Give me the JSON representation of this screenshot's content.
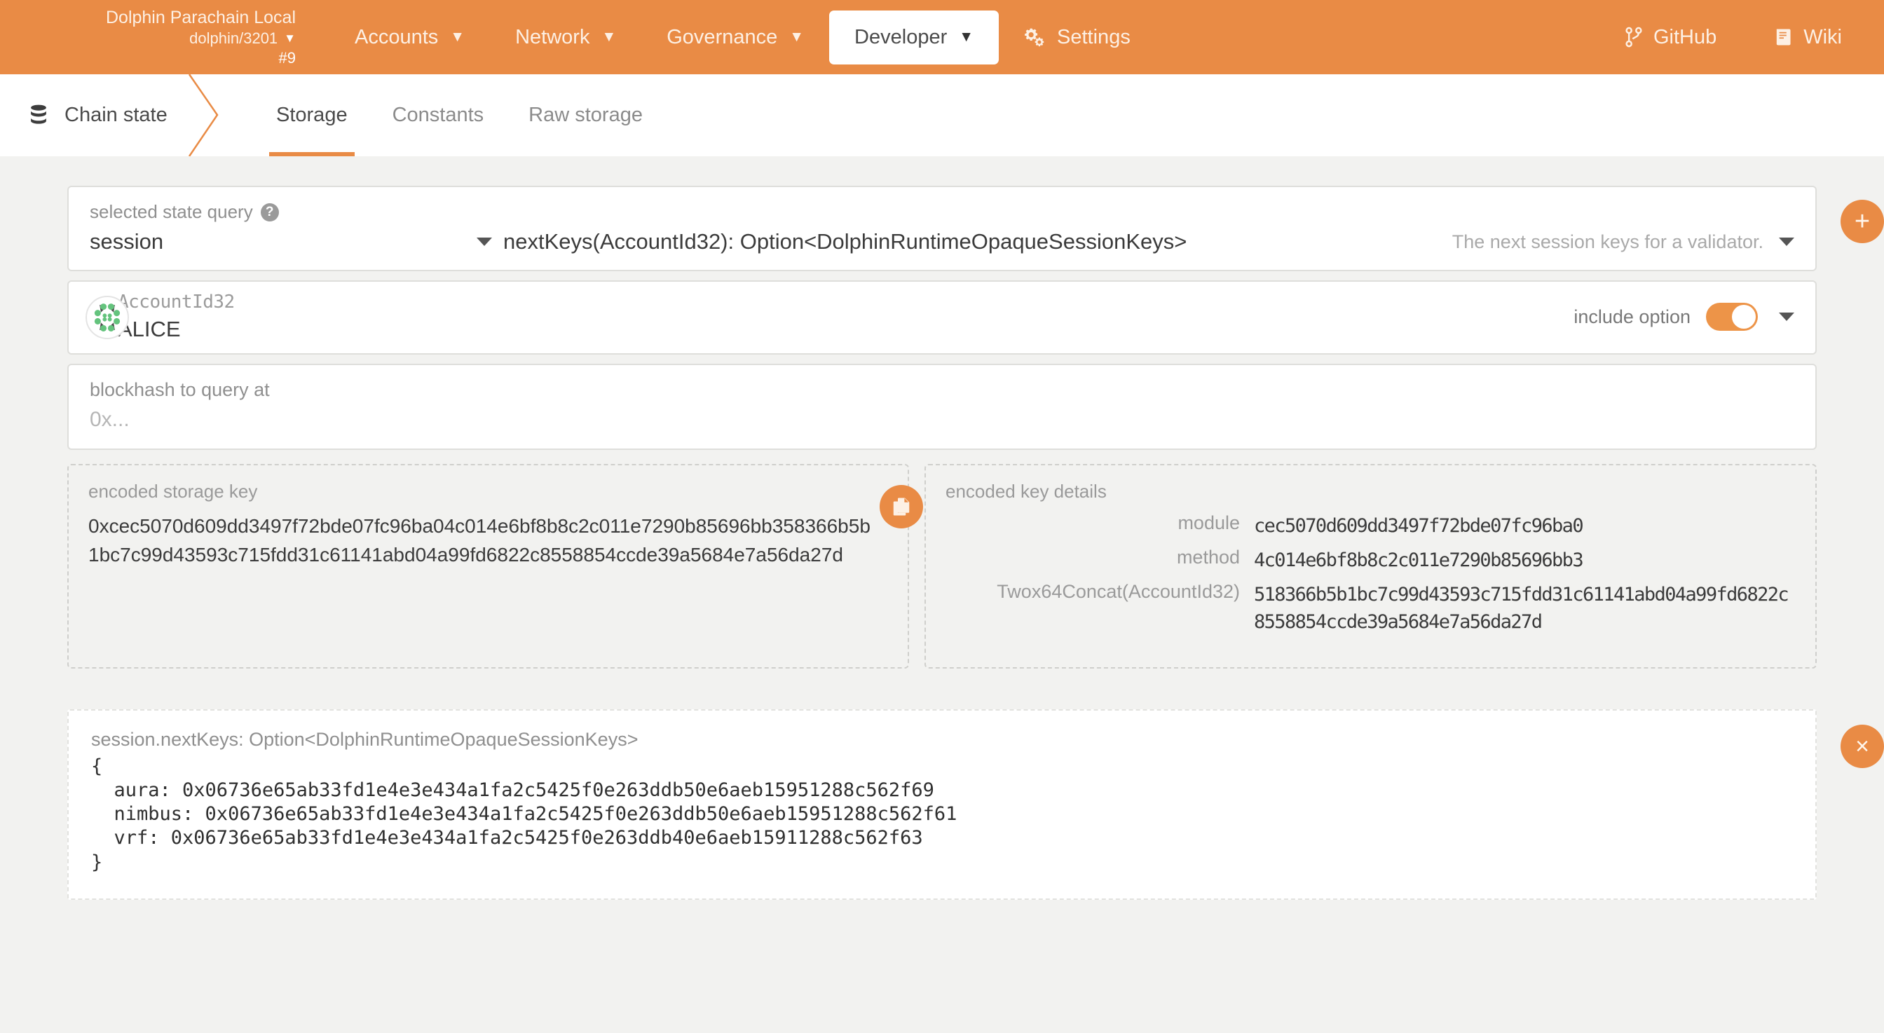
{
  "topbar": {
    "chain_name": "Dolphin Parachain Local",
    "chain_spec": "dolphin/3201",
    "block_number": "#9",
    "nav": [
      {
        "label": "Accounts",
        "caret": "caret-down-icon",
        "active": false
      },
      {
        "label": "Network",
        "caret": "caret-down-icon",
        "active": false
      },
      {
        "label": "Governance",
        "caret": "caret-down-icon",
        "active": false
      },
      {
        "label": "Developer",
        "caret": "caret-down-icon",
        "active": true
      },
      {
        "label": "Settings",
        "icon": "gears-icon",
        "active": false
      }
    ],
    "right": [
      {
        "label": "GitHub",
        "icon": "git-branch-icon"
      },
      {
        "label": "Wiki",
        "icon": "book-icon"
      }
    ]
  },
  "tabbar": {
    "breadcrumb": "Chain state",
    "breadcrumb_icon": "database-icon",
    "tabs": [
      {
        "label": "Storage",
        "active": true
      },
      {
        "label": "Constants",
        "active": false
      },
      {
        "label": "Raw storage",
        "active": false
      }
    ]
  },
  "query": {
    "label": "selected state query",
    "help_icon": "question-mark-icon",
    "module": "session",
    "method": "nextKeys(AccountId32): Option<DolphinRuntimeOpaqueSessionKeys>",
    "description": "The next session keys for a validator.",
    "add_button": "+"
  },
  "account": {
    "type": "AccountId32",
    "value": "ALICE",
    "identicon": "polkadot-identicon",
    "include_option_label": "include option",
    "include_option_on": true
  },
  "blockhash": {
    "label": "blockhash to query at",
    "placeholder": "0x..."
  },
  "encoded_key": {
    "title": "encoded storage key",
    "value": "0xcec5070d609dd3497f72bde07fc96ba04c014e6bf8b8c2c011e7290b85696bb358366b5b1bc7c99d43593c715fdd31c61141abd04a99fd6822c8558854ccde39a5684e7a56da27d",
    "copy_icon": "copy-icon"
  },
  "key_details": {
    "title": "encoded key details",
    "rows": [
      {
        "key": "module",
        "value": "cec5070d609dd3497f72bde07fc96ba0"
      },
      {
        "key": "method",
        "value": "4c014e6bf8b8c2c011e7290b85696bb3"
      },
      {
        "key": "Twox64Concat(AccountId32)",
        "value": "518366b5b1bc7c99d43593c715fdd31c61141abd04a99fd6822c8558854ccde39a5684e7a56da27d"
      }
    ]
  },
  "result": {
    "header": "session.nextKeys: Option<DolphinRuntimeOpaqueSessionKeys>",
    "code": "{\n  aura: 0x06736e65ab33fd1e4e3e434a1fa2c5425f0e263ddb50e6aeb15951288c562f69\n  nimbus: 0x06736e65ab33fd1e4e3e434a1fa2c5425f0e263ddb50e6aeb15951288c562f61\n  vrf: 0x06736e65ab33fd1e4e3e434a1fa2c5425f0e263ddb40e6aeb15911288c562f63\n}",
    "close_button": "×"
  },
  "colors": {
    "brand_orange": "#e98b45",
    "page_bg": "#f2f2f0",
    "toggle_on": "#ed9448"
  }
}
